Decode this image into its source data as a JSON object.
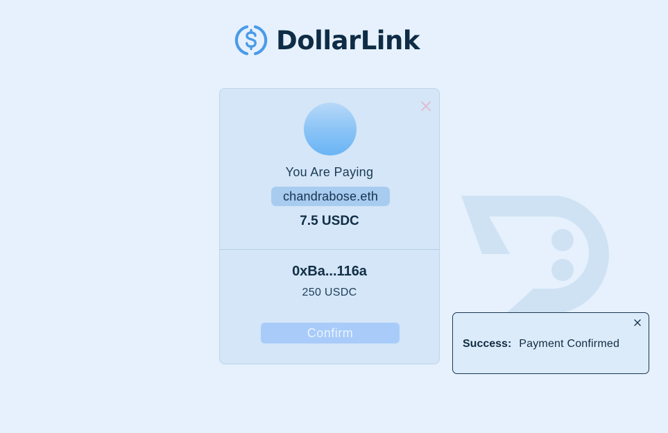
{
  "brand": {
    "name": "DollarLink",
    "logo_icon": "dollar-circle-icon",
    "accent_color": "#4a9be8"
  },
  "payment_card": {
    "close_icon": "close-icon",
    "avatar_icon": "avatar",
    "paying_label": "You Are Paying",
    "recipient": "chandrabose.eth",
    "amount": "7.5 USDC",
    "wallet_address": "0xBa...116a",
    "wallet_balance": "250 USDC",
    "confirm_label": "Confirm"
  },
  "toast": {
    "title": "Success:",
    "message": "Payment Confirmed",
    "close_icon": "close-icon"
  },
  "watermark": {
    "icon": "dollarlink-d-logo-icon"
  }
}
